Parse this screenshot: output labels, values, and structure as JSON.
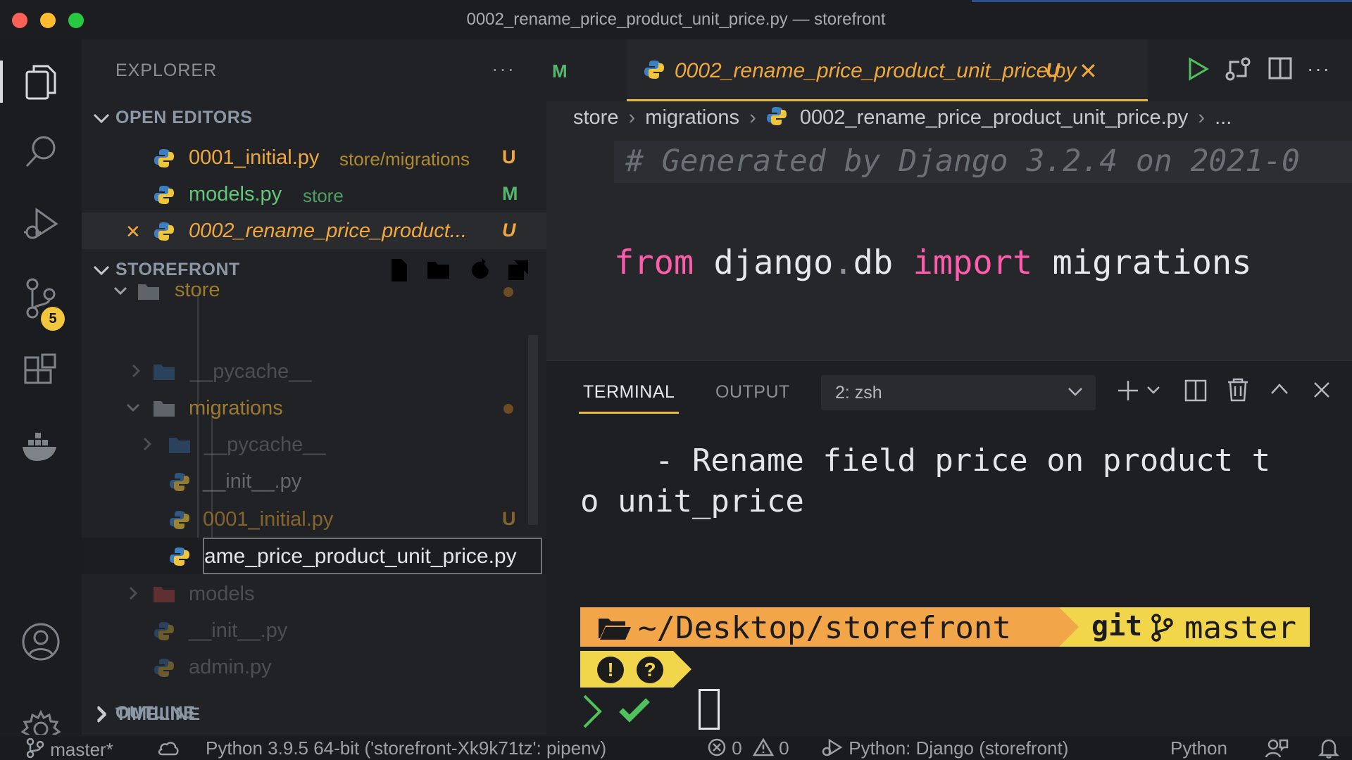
{
  "window": {
    "title": "0002_rename_price_product_unit_price.py — storefront"
  },
  "activity_bar": {
    "items": [
      "explorer-icon",
      "search-icon",
      "run-debug-icon",
      "source-control-icon",
      "extensions-icon",
      "docker-icon",
      "account-icon",
      "settings-icon"
    ],
    "source_control_badge": "5"
  },
  "sidebar": {
    "title": "EXPLORER",
    "more": "···",
    "open_editors": {
      "label": "OPEN EDITORS",
      "items": [
        {
          "name": "0001_initial.py",
          "path": "store/migrations",
          "status": "U"
        },
        {
          "name": "models.py",
          "path": "store",
          "status": "M"
        },
        {
          "name": "0002_rename_price_product...",
          "path": "",
          "status": "U"
        }
      ],
      "close_glyph": "✕"
    },
    "storefront": {
      "label": "STOREFRONT",
      "tree": {
        "store": "store",
        "pycache_1": "__pycache__",
        "migrations": "migrations",
        "pycache_2": "__pycache__",
        "init_migrations": "__init__.py",
        "initial": "0001_initial.py",
        "initial_status": "U",
        "rename_value": "ame_price_product_unit_price.py",
        "models": "models",
        "init_store": "__init__.py",
        "admin": "admin.py"
      }
    },
    "outline_label": "OUTLINE",
    "timeline_label": "TIMELINE"
  },
  "editor": {
    "tab_m": "M",
    "active_tab": {
      "name": "0002_rename_price_product_unit_price.py",
      "status": "U",
      "close": "✕"
    },
    "more": "···",
    "breadcrumb": [
      "store",
      "migrations",
      "0002_rename_price_product_unit_price.py",
      "..."
    ],
    "comment_line": "# Generated by Django 3.2.4 on 2021-0",
    "code": {
      "kw_from": "from",
      "mod_a": "django",
      "dot": ".",
      "mod_b": "db",
      "kw_import": "import",
      "name": "migrations"
    }
  },
  "panel": {
    "tabs": [
      "TERMINAL",
      "OUTPUT"
    ],
    "shell": "2: zsh",
    "terminal_lines": [
      "    - Rename field price on product t",
      "o unit_price"
    ],
    "prompt_path": "~/Desktop/storefront",
    "prompt_git": "git",
    "prompt_branch": "master",
    "prompt_icons": [
      "!",
      "?"
    ]
  },
  "statusbar": {
    "branch": "master*",
    "interpreter": "Python 3.9.5 64-bit ('storefront-Xk9k71tz': pipenv)",
    "errors": "0",
    "warnings": "0",
    "debug_config": "Python: Django (storefront)",
    "language": "Python"
  },
  "colors": {
    "accent_yellow": "#e9bc38",
    "modified_green": "#55b76b",
    "untracked_orange": "#f0a83c",
    "keyword_pink": "#ff5cad"
  }
}
